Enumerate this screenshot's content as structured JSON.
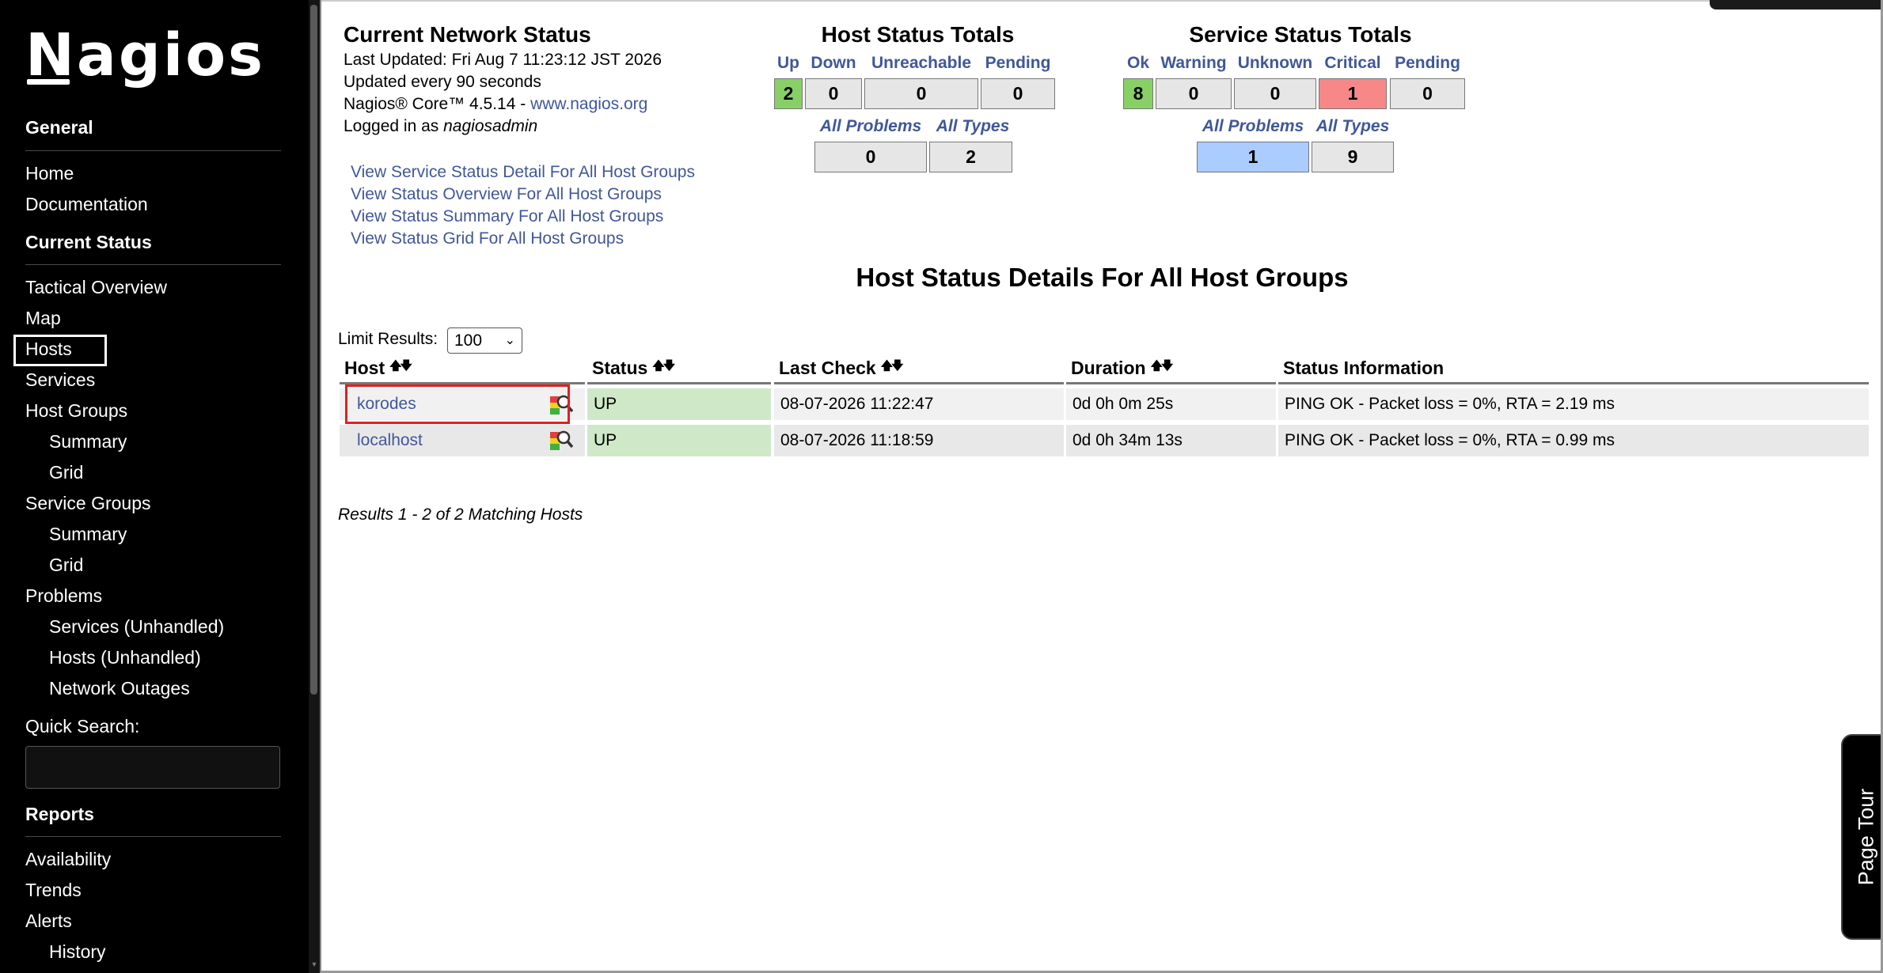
{
  "sidebar": {
    "logo": "Nagios",
    "sections": {
      "general": "General",
      "current_status": "Current Status",
      "reports": "Reports"
    },
    "general_items": [
      "Home",
      "Documentation"
    ],
    "status_items": {
      "tactical_overview": "Tactical Overview",
      "map": "Map",
      "hosts": "Hosts",
      "services": "Services",
      "host_groups": "Host Groups",
      "hg_summary": "Summary",
      "hg_grid": "Grid",
      "service_groups": "Service Groups",
      "sg_summary": "Summary",
      "sg_grid": "Grid",
      "problems": "Problems",
      "services_unhandled": "Services (Unhandled)",
      "hosts_unhandled": "Hosts (Unhandled)",
      "network_outages": "Network Outages"
    },
    "quick_search_label": "Quick Search:",
    "quick_search_value": "",
    "report_items": {
      "availability": "Availability",
      "trends": "Trends",
      "alerts": "Alerts",
      "history": "History"
    }
  },
  "status": {
    "title": "Current Network Status",
    "last_updated": "Last Updated: Fri Aug 7 11:23:12 JST 2026",
    "update_interval": "Updated every 90 seconds",
    "version_prefix": "Nagios® Core™ 4.5.14 - ",
    "version_link": "www.nagios.org",
    "logged_in_prefix": "Logged in as ",
    "user": "nagiosadmin",
    "links": [
      "View Service Status Detail For All Host Groups",
      "View Status Overview For All Host Groups",
      "View Status Summary For All Host Groups",
      "View Status Grid For All Host Groups"
    ]
  },
  "host_totals": {
    "title": "Host Status Totals",
    "labels": [
      "Up",
      "Down",
      "Unreachable",
      "Pending"
    ],
    "values": [
      "2",
      "0",
      "0",
      "0"
    ],
    "summary_labels": [
      "All Problems",
      "All Types"
    ],
    "summary_values": [
      "0",
      "2"
    ]
  },
  "service_totals": {
    "title": "Service Status Totals",
    "labels": [
      "Ok",
      "Warning",
      "Unknown",
      "Critical",
      "Pending"
    ],
    "values": [
      "8",
      "0",
      "0",
      "1",
      "0"
    ],
    "summary_labels": [
      "All Problems",
      "All Types"
    ],
    "summary_values": [
      "1",
      "9"
    ]
  },
  "details": {
    "title": "Host Status Details For All Host Groups",
    "limit_label": "Limit Results:",
    "limit_value": "100",
    "columns": [
      "Host",
      "Status",
      "Last Check",
      "Duration",
      "Status Information"
    ],
    "rows": [
      {
        "host": "korodes",
        "status": "UP",
        "last_check": "08-07-2026 11:22:47",
        "duration": "0d 0h 0m 25s",
        "info": "PING OK - Packet loss = 0%, RTA = 2.19 ms"
      },
      {
        "host": "localhost",
        "status": "UP",
        "last_check": "08-07-2026 11:18:59",
        "duration": "0d 0h 34m 13s",
        "info": "PING OK - Packet loss = 0%, RTA = 0.99 ms"
      }
    ],
    "results_text": "Results 1 - 2 of 2 Matching Hosts"
  },
  "page_tour": "Page Tour",
  "colors": {
    "sidebar_bg": "#000000",
    "link": "#40579a",
    "up_green": "#88d066",
    "critical_red": "#f88888",
    "problem_blue": "#aaccff",
    "row_up": "#cfe8c8"
  }
}
